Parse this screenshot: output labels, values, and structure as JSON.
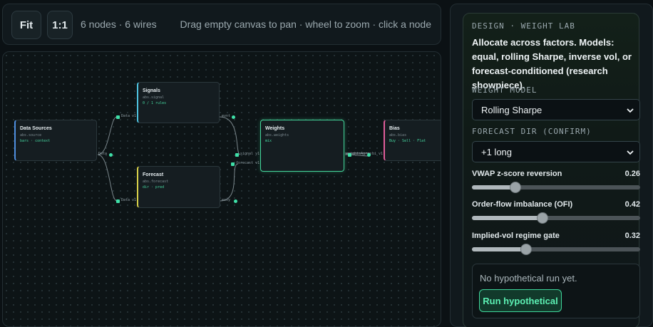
{
  "toolbar": {
    "fit_label": "Fit",
    "one_to_one_label": "1:1",
    "stats": "6 nodes · 6 wires",
    "hint": "Drag empty canvas to pan · wheel to zoom · click a node"
  },
  "graph": {
    "nodes": {
      "sources": {
        "title": "Data Sources",
        "type": "abs.source",
        "value": "bars · context"
      },
      "signals": {
        "title": "Signals",
        "type": "abs.signal",
        "value": "0 / 1 rules"
      },
      "forecast": {
        "title": "Forecast",
        "type": "abs.forecast",
        "value": "dir · pred"
      },
      "weights": {
        "title": "Weights",
        "type": "abs.weights",
        "value": "mix"
      },
      "bias": {
        "title": "Bias",
        "type": "abs.bias",
        "value": "Buy · Sell · Flat"
      }
    },
    "ports": {
      "sources_out": "Data",
      "signals_in": "Data v1",
      "signals_out": "evnt",
      "forecast_in": "Data v1",
      "forecast_out": "ecsy",
      "weights_in_signal": "signal v1",
      "weights_in_forecast": "forecast v1",
      "weights_out": "weightsAgree",
      "bias_in": "bi v1"
    }
  },
  "panel": {
    "eyebrow": "DESIGN · WEIGHT LAB",
    "description": "Allocate across factors. Models: equal, rolling Sharpe, inverse vol, or forecast-conditioned (research showpiece).",
    "weight_model": {
      "label": "WEIGHT MODEL",
      "value": "Rolling Sharpe"
    },
    "forecast_dir": {
      "label": "FORECAST DIR (CONFIRM)",
      "value": "+1 long"
    },
    "sliders": [
      {
        "label": "VWAP z-score reversion",
        "value": "0.26",
        "fraction": 0.26
      },
      {
        "label": "Order-flow imbalance (OFI)",
        "value": "0.42",
        "fraction": 0.42
      },
      {
        "label": "Implied-vol regime gate",
        "value": "0.32",
        "fraction": 0.32
      }
    ],
    "run": {
      "message": "No hypothetical run yet.",
      "button_label": "Run hypothetical"
    }
  },
  "colors": {
    "accent": "#3fe0a8",
    "sources": "#4f8fe0",
    "signals": "#4fc3e0",
    "forecast": "#d9d14a",
    "bias": "#e05d9a",
    "weights": "#44d69b"
  }
}
